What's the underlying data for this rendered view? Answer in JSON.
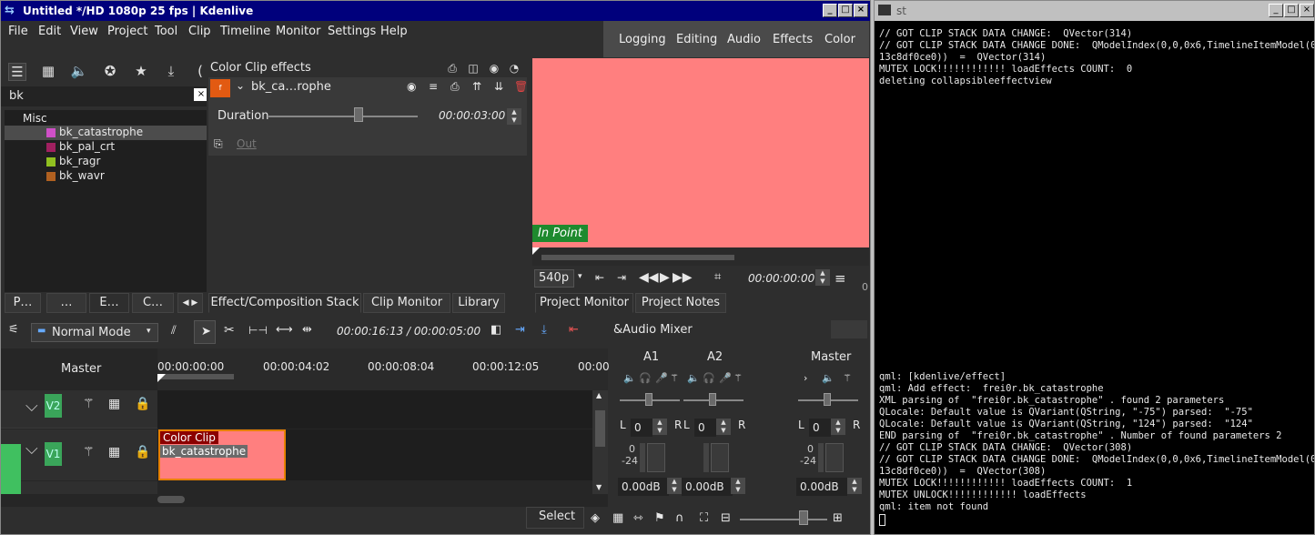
{
  "kdenlive": {
    "title": "Untitled */HD 1080p 25 fps | Kdenlive",
    "menu": [
      "File",
      "Edit",
      "View",
      "Project",
      "Tool",
      "Clip",
      "Timeline",
      "Monitor",
      "Settings",
      "Help"
    ],
    "workspaces": [
      "Logging",
      "Editing",
      "Audio",
      "Effects",
      "Color"
    ],
    "effects_search_value": "bk",
    "effects_tree": {
      "category": "Misc",
      "items": [
        {
          "label": "bk_catastrophe",
          "color": "#d050c8",
          "selected": true
        },
        {
          "label": "bk_pal_crt",
          "color": "#a02060"
        },
        {
          "label": "bk_ragr",
          "color": "#90c020"
        },
        {
          "label": "bk_wavr",
          "color": "#b06020"
        }
      ]
    },
    "effect_stack": {
      "title": "Color Clip effects",
      "effect_name": "bk_ca…rophe",
      "duration_label": "Duration",
      "duration_value": "00:00:03:00",
      "out_label": "Out"
    },
    "monitor": {
      "in_point_label": "In Point",
      "resolution": "540p",
      "timecode": "00:00:00:00",
      "bg_color": "#ff7f7f",
      "zoom_zero": "0"
    },
    "left_tabs": [
      "P…",
      "…",
      "E…",
      "C…"
    ],
    "middle_tabs": [
      "Effect/Composition Stack",
      "Clip Monitor",
      "Library"
    ],
    "right_tabs": [
      "Project Monitor",
      "Project Notes"
    ],
    "timeline_toolbar": {
      "mode": "Normal Mode",
      "timecode": "00:00:16:13 / 00:00:05:00"
    },
    "ruler": [
      "00:00:00:00",
      "00:00:04:02",
      "00:00:08:04",
      "00:00:12:05",
      "00:00"
    ],
    "tracks": {
      "master": "Master",
      "v2": "V2",
      "v1": "V1"
    },
    "clip": {
      "type_label": "Color Clip",
      "effect_label": "bk_catastrophe"
    },
    "audio_mixer": {
      "title": "&Audio Mixer",
      "channels": [
        {
          "name": "A1",
          "pan": "0",
          "db": "0.00dB"
        },
        {
          "name": "A2",
          "pan": "0",
          "db": "0.00dB"
        },
        {
          "name": "Master",
          "pan": "0",
          "db": "0.00dB"
        }
      ],
      "l_label": "L",
      "r_label": "R",
      "scale_top": "0",
      "scale_mid": "-24"
    },
    "status": {
      "select_label": "Select"
    }
  },
  "terminal": {
    "title": "st",
    "lines_top": [
      "// GOT CLIP STACK DATA CHANGE:  QVector(314)",
      "// GOT CLIP STACK DATA CHANGE DONE:  QModelIndex(0,0,0x6,TimelineItemModel(0x56",
      "13c8df0ce0))  =  QVector(314)",
      "MUTEX LOCK!!!!!!!!!!!! loadEffects COUNT:  0",
      "deleting collapsibleeffectview"
    ],
    "lines_bottom": [
      "qml: [kdenlive/effect]",
      "qml: Add effect:  frei0r.bk_catastrophe",
      "XML parsing of  \"frei0r.bk_catastrophe\" . found 2 parameters",
      "QLocale: Default value is QVariant(QString, \"-75\") parsed:  \"-75\"",
      "QLocale: Default value is QVariant(QString, \"124\") parsed:  \"124\"",
      "END parsing of  \"frei0r.bk_catastrophe\" . Number of found parameters 2",
      "// GOT CLIP STACK DATA CHANGE:  QVector(308)",
      "// GOT CLIP STACK DATA CHANGE DONE:  QModelIndex(0,0,0x6,TimelineItemModel(0x56",
      "13c8df0ce0))  =  QVector(308)",
      "MUTEX LOCK!!!!!!!!!!!! loadEffects COUNT:  1",
      "MUTEX UNLOCK!!!!!!!!!!!! loadEffects",
      "qml: item not found"
    ]
  }
}
